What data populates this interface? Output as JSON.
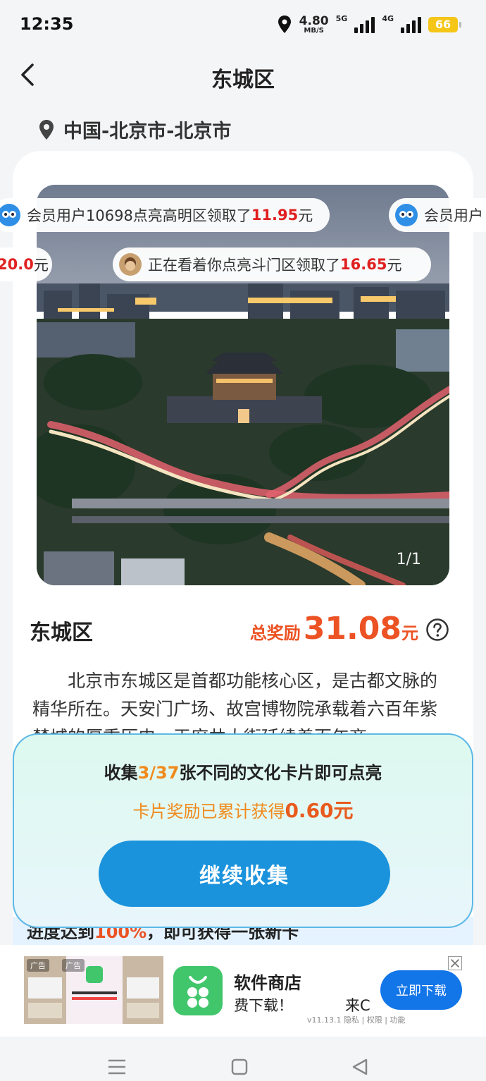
{
  "status": {
    "time": "12:35",
    "speed_value": "4.80",
    "speed_unit": "MB/S",
    "net1": "5G",
    "net2": "4G",
    "battery": "66"
  },
  "header": {
    "title": "东城区"
  },
  "location": {
    "text": "中国-北京市-北京市"
  },
  "ticker": [
    {
      "pre": "会员用户10698点亮高明区领取了",
      "amount": "11.95",
      "unit": "元"
    },
    {
      "pre": "会员用户",
      "amount": "",
      "unit": ""
    },
    {
      "pre": "",
      "amount": "20.0",
      "unit": "元"
    },
    {
      "pre": "正在看着你点亮斗门区领取了",
      "amount": "16.65",
      "unit": "元"
    }
  ],
  "photo": {
    "counter": "1/1"
  },
  "district": {
    "name": "东城区",
    "reward_label": "总奖励",
    "reward_amount": "31.08",
    "reward_unit": "元",
    "description": "北京市东城区是首都功能核心区，是古都文脉的精华所在。天安门广场、故宫博物院承载着六百年紫禁城的厚重历史，王府井大街延续着百年商…"
  },
  "peek": {
    "pre": "进度达到",
    "highlight": "100%",
    "post": "，即可获得一张新卡"
  },
  "collect": {
    "pre": "收集",
    "progress": "3/37",
    "post": "张不同的文化卡片即可点亮",
    "earned_label": "卡片奖励已累计获得",
    "earned_amount": "0.60元",
    "button": "继续收集"
  },
  "ad": {
    "tag": "广告",
    "app_name": "软件商店",
    "slogan": "费下载！",
    "slogan2": "来C",
    "button": "立即下载",
    "meta": "v11.13.1  隐私 | 权限 | 功能"
  },
  "colors": {
    "accent_orange": "#ec5223",
    "button_blue": "#1b93dc",
    "ad_blue": "#1275e8"
  }
}
